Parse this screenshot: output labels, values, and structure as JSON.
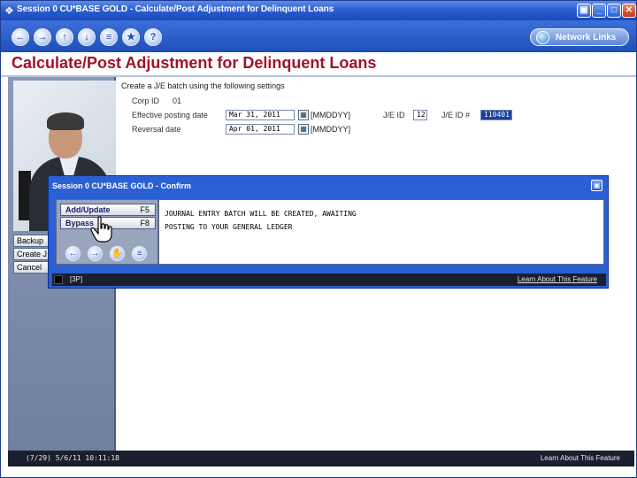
{
  "window": {
    "title": "Session 0 CU*BASE GOLD - Calculate/Post Adjustment for Delinquent Loans",
    "controls": {
      "restore": "▣",
      "minimize": "_",
      "maximize": "□",
      "close": "✕"
    }
  },
  "toolbar": {
    "nav_icons": [
      "back-icon",
      "forward-icon",
      "up-icon",
      "down-icon",
      "menu-icon",
      "favorites-icon",
      "help-icon"
    ],
    "network_links_label": "Network Links"
  },
  "page": {
    "title": "Calculate/Post Adjustment for Delinquent Loans"
  },
  "side_buttons": {
    "backup": "Backup",
    "create": "Create J",
    "cancel": "Cancel"
  },
  "form": {
    "intro": "Create a J/E batch using the following settings",
    "corp_id_label": "Corp ID",
    "corp_id_value": "01",
    "effective_label": "Effective posting date",
    "effective_value": "Mar 31, 2011",
    "effective_format": "[MMDDYY]",
    "reversal_label": "Reversal date",
    "reversal_value": "Apr 01, 2011",
    "reversal_format": "[MMDDYY]",
    "je_id_label": "J/E ID",
    "je_id_value": "12",
    "je_num_label": "J/E ID #",
    "je_num_value": "110401"
  },
  "status_bar": {
    "left": "(7/29) 5/6/11 10:11:18",
    "right": "Learn About This Feature"
  },
  "dialog": {
    "title": "Session 0 CU*BASE GOLD - Confirm",
    "maximize_glyph": "▣",
    "buttons": [
      {
        "label": "Add/Update",
        "key": "F5"
      },
      {
        "label": "Bypass",
        "key": "F8"
      }
    ],
    "message_line1": "JOURNAL ENTRY BATCH WILL BE CREATED, AWAITING",
    "message_line2": "POSTING TO YOUR GENERAL LEDGER",
    "status_left": "[3P]",
    "status_right": "Learn About This Feature"
  },
  "colors": {
    "title_red": "#a1122a",
    "chrome_blue": "#2b5fd4",
    "status_dark": "#1a1f2e"
  }
}
